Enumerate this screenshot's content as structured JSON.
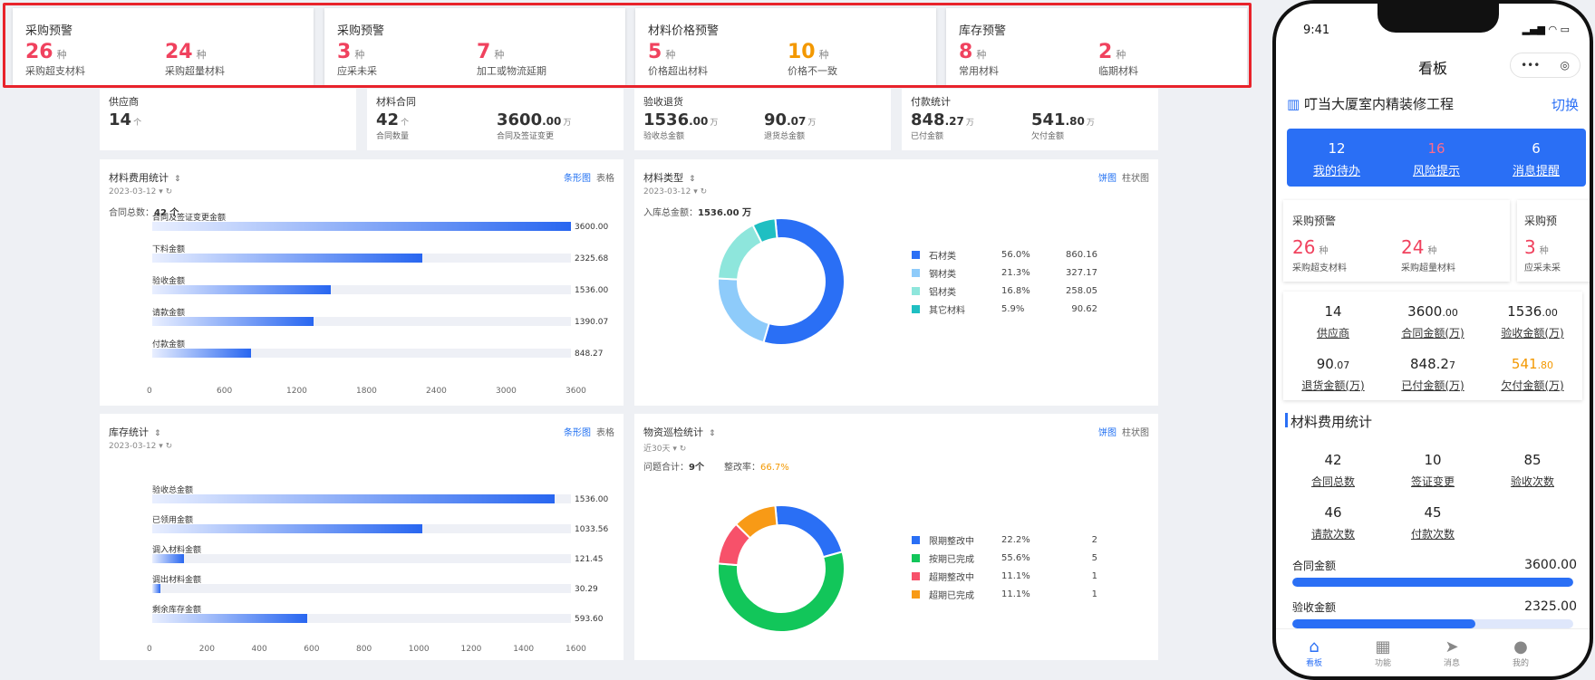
{
  "warnings": [
    {
      "title": "采购预警",
      "items": [
        {
          "value": "26",
          "unit": "种",
          "label": "采购超支材料",
          "color": "red"
        },
        {
          "value": "24",
          "unit": "种",
          "label": "采购超量材料",
          "color": "red"
        }
      ]
    },
    {
      "title": "采购预警",
      "items": [
        {
          "value": "3",
          "unit": "种",
          "label": "应采未采",
          "color": "red"
        },
        {
          "value": "7",
          "unit": "种",
          "label": "加工或物流延期",
          "color": "red"
        }
      ]
    },
    {
      "title": "材料价格预警",
      "items": [
        {
          "value": "5",
          "unit": "种",
          "label": "价格超出材料",
          "color": "red"
        },
        {
          "value": "10",
          "unit": "种",
          "label": "价格不一致",
          "color": "orange"
        }
      ]
    },
    {
      "title": "库存预警",
      "items": [
        {
          "value": "8",
          "unit": "种",
          "label": "常用材料",
          "color": "red"
        },
        {
          "value": "2",
          "unit": "种",
          "label": "临期材料",
          "color": "red"
        }
      ]
    }
  ],
  "summary": [
    {
      "title": "供应商",
      "items": [
        {
          "value": "14",
          "dec": "",
          "unit": "个",
          "label": ""
        }
      ]
    },
    {
      "title": "材料合同",
      "items": [
        {
          "value": "42",
          "dec": "",
          "unit": "个",
          "label": "合同数量"
        },
        {
          "value": "3600",
          "dec": ".00",
          "unit": "万",
          "label": "合同及签证变更"
        }
      ]
    },
    {
      "title": "验收退货",
      "items": [
        {
          "value": "1536",
          "dec": ".00",
          "unit": "万",
          "label": "验收总金额"
        },
        {
          "value": "90",
          "dec": ".07",
          "unit": "万",
          "label": "退货总金额"
        }
      ]
    },
    {
      "title": "付款统计",
      "items": [
        {
          "value": "848",
          "dec": ".27",
          "unit": "万",
          "label": "已付金额"
        },
        {
          "value": "541",
          "dec": ".80",
          "unit": "万",
          "label": "欠付金额",
          "color": "orange"
        }
      ]
    }
  ],
  "panel_cost": {
    "title": "材料费用统计",
    "date": "2023-03-12",
    "tab_active": "条形图",
    "tab_other": "表格",
    "info_label": "合同总数：",
    "info_value": "42 个"
  },
  "panel_type": {
    "title": "材料类型",
    "date": "2023-03-12",
    "tab_active": "饼图",
    "tab_other": "柱状图",
    "info_label": "入库总金额：",
    "info_value": "1536.00 万"
  },
  "panel_stock": {
    "title": "库存统计",
    "date": "2023-03-12",
    "tab_active": "条形图",
    "tab_other": "表格"
  },
  "panel_check": {
    "title": "物资巡检统计",
    "date": "近30天",
    "tab_active": "饼图",
    "tab_other": "柱状图",
    "info_label1": "问题合计：",
    "info_value1": "9个",
    "info_label2": "整改率：",
    "info_value2": "66.7%"
  },
  "chart_data": [
    {
      "type": "bar",
      "title": "材料费用统计",
      "categories": [
        "合同及签证变更金额",
        "下料金额",
        "验收金额",
        "请款金额",
        "付款金额"
      ],
      "values": [
        3600.0,
        2325.68,
        1536.0,
        1390.07,
        848.27
      ],
      "value_labels": [
        "3600.00",
        "2325.68",
        "1536.00",
        "1390.07",
        "848.27"
      ],
      "xlim": [
        0,
        3600
      ],
      "ticks": [
        "0",
        "600",
        "1200",
        "1800",
        "2400",
        "3000",
        "3600"
      ]
    },
    {
      "type": "pie",
      "title": "材料类型",
      "labels": [
        "石材类",
        "钢材类",
        "铝材类",
        "其它材料"
      ],
      "percents": [
        "56.0%",
        "21.3%",
        "16.8%",
        "5.9%"
      ],
      "values": [
        "860.16",
        "327.17",
        "258.05",
        "90.62"
      ],
      "colors": [
        "#2a6ff5",
        "#8ecbfa",
        "#8ee6dc",
        "#1fbfc2"
      ]
    },
    {
      "type": "bar",
      "title": "库存统计",
      "categories": [
        "验收总金额",
        "已领用金额",
        "调入材料金额",
        "调出材料金额",
        "剩余库存金额"
      ],
      "values": [
        1536.0,
        1033.56,
        121.45,
        30.29,
        593.6
      ],
      "value_labels": [
        "1536.00",
        "1033.56",
        "121.45",
        "30.29",
        "593.60"
      ],
      "xlim": [
        0,
        1600
      ],
      "ticks": [
        "0",
        "200",
        "400",
        "600",
        "800",
        "1000",
        "1200",
        "1400",
        "1600"
      ]
    },
    {
      "type": "pie",
      "title": "物资巡检统计",
      "labels": [
        "限期整改中",
        "按期已完成",
        "超期整改中",
        "超期已完成"
      ],
      "percents": [
        "22.2%",
        "55.6%",
        "11.1%",
        "11.1%"
      ],
      "values": [
        "2",
        "5",
        "1",
        "1"
      ],
      "colors": [
        "#2a6ff5",
        "#12c65a",
        "#f7516a",
        "#f89a16"
      ]
    }
  ],
  "phone": {
    "time": "9:41",
    "nav_title": "看板",
    "project": "叮当大厦室内精装修工程",
    "switch": "切换",
    "blue": [
      {
        "value": "12",
        "label": "我的待办"
      },
      {
        "value": "16",
        "label": "风险提示",
        "red": true
      },
      {
        "value": "6",
        "label": "消息提醒"
      }
    ],
    "warn_title": "采购预警",
    "warn_title2": "采购预",
    "warn_items": [
      {
        "value": "26",
        "unit": "种",
        "label": "采购超支材料"
      },
      {
        "value": "24",
        "unit": "种",
        "label": "采购超量材料"
      },
      {
        "value": "3",
        "unit": "种",
        "label": "应采未采"
      }
    ],
    "stats": [
      {
        "value": "14",
        "dec": "",
        "label": "供应商"
      },
      {
        "value": "3600",
        "dec": ".00",
        "label": "合同金额(万)"
      },
      {
        "value": "1536",
        "dec": ".00",
        "label": "验收金额(万)"
      },
      {
        "value": "90",
        "dec": ".07",
        "label": "退货金额(万)"
      },
      {
        "value": "848.2",
        "dec": "7",
        "label": "已付金额(万)"
      },
      {
        "value": "541",
        "dec": ".80",
        "label": "欠付金额(万)",
        "orange": true
      }
    ],
    "section_title": "材料费用统计",
    "counts": [
      {
        "value": "42",
        "label": "合同总数"
      },
      {
        "value": "10",
        "label": "签证变更"
      },
      {
        "value": "85",
        "label": "验收次数"
      },
      {
        "value": "46",
        "label": "请款次数"
      },
      {
        "value": "45",
        "label": "付款次数"
      }
    ],
    "progress": [
      {
        "label": "合同金额",
        "value": "3600.00",
        "fraction": 1.0
      },
      {
        "label": "验收金额",
        "value": "2325.00",
        "fraction": 0.65
      }
    ],
    "tabbar": [
      "看板",
      "功能",
      "消息",
      "我的"
    ]
  }
}
